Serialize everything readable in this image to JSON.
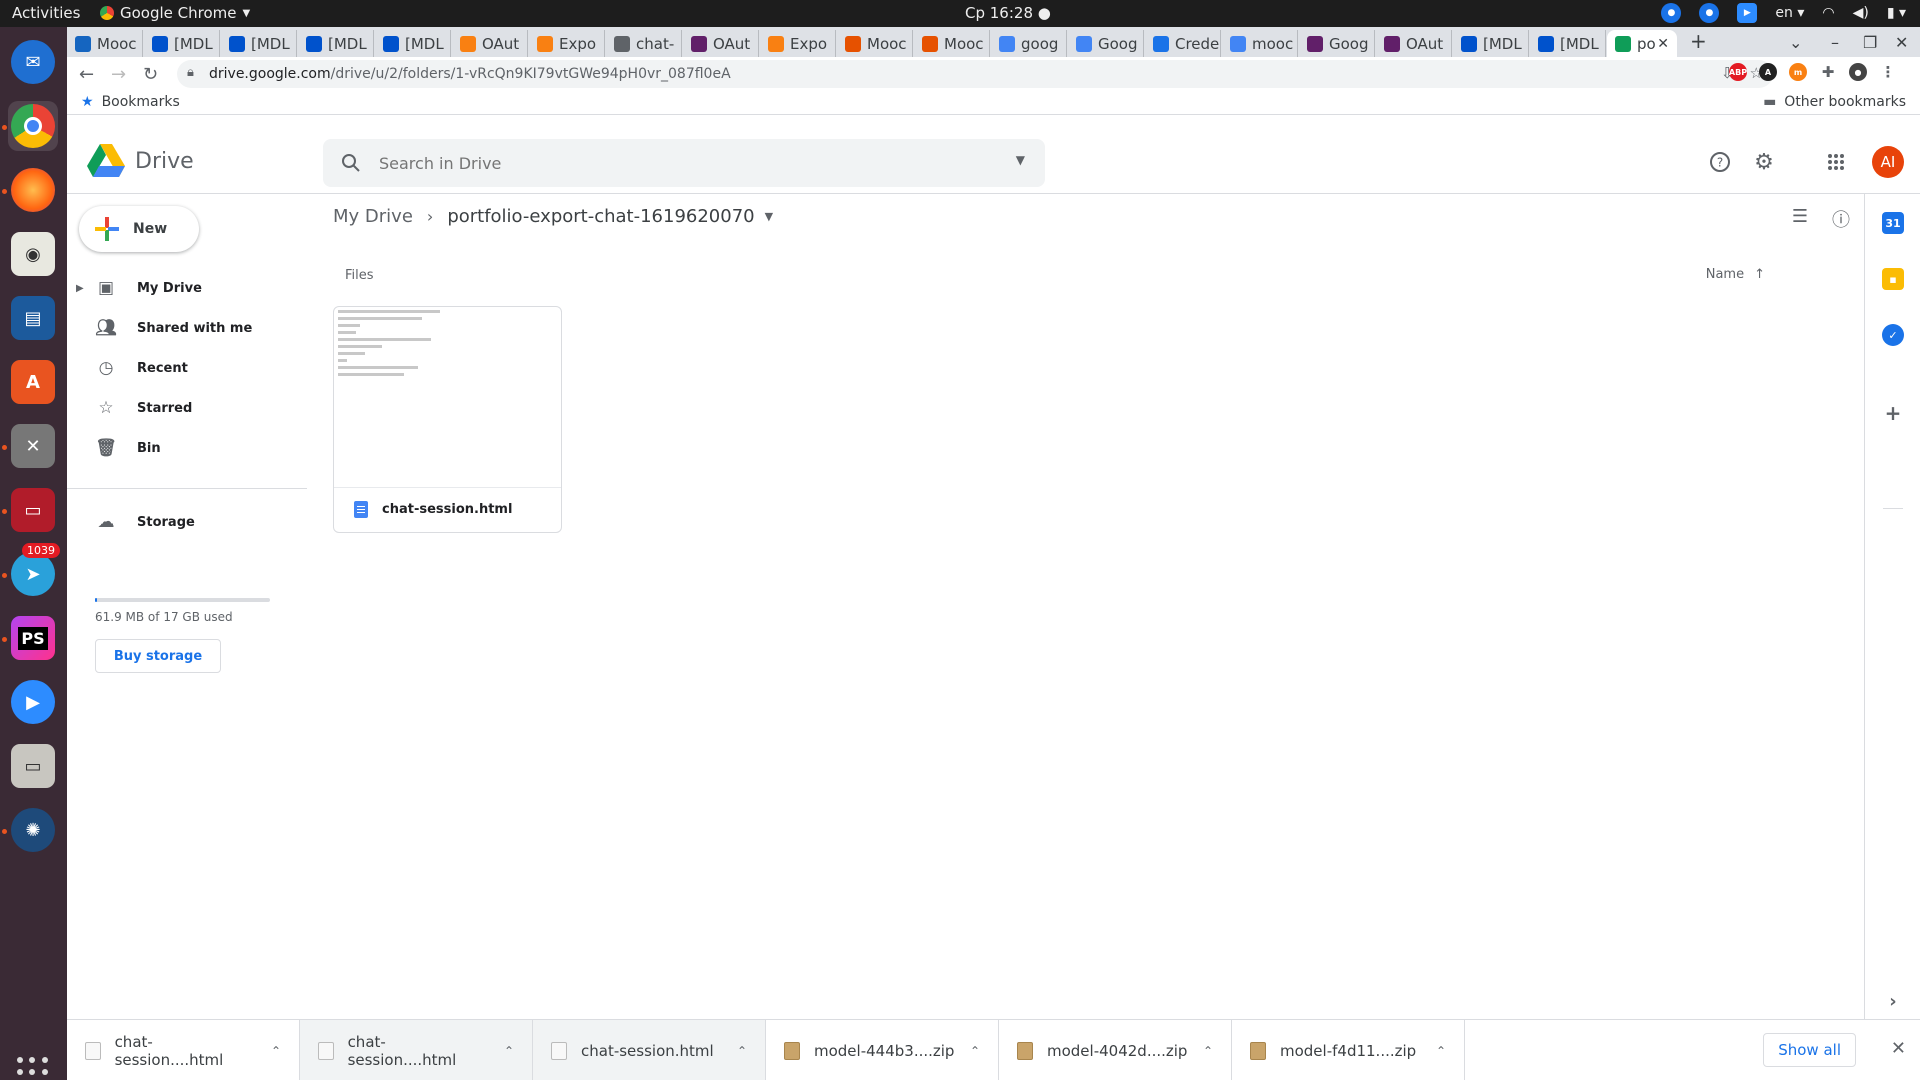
{
  "system": {
    "activities": "Activities",
    "app_name": "Google Chrome",
    "clock": "Ср 16:28",
    "language": "en",
    "dock_badge": "1039"
  },
  "browser": {
    "tabs": [
      {
        "label": "Mooc",
        "fav_color": "#1565c0"
      },
      {
        "label": "[MDL",
        "fav_color": "#0052cc"
      },
      {
        "label": "[MDL",
        "fav_color": "#0052cc"
      },
      {
        "label": "[MDL",
        "fav_color": "#0052cc"
      },
      {
        "label": "[MDL",
        "fav_color": "#0052cc"
      },
      {
        "label": "OAut",
        "fav_color": "#f98012"
      },
      {
        "label": "Expo",
        "fav_color": "#f98012"
      },
      {
        "label": "chat-",
        "fav_color": "#5f6368"
      },
      {
        "label": "OAut",
        "fav_color": "#611f69"
      },
      {
        "label": "Expo",
        "fav_color": "#f98012"
      },
      {
        "label": "Mooc",
        "fav_color": "#e65100"
      },
      {
        "label": "Mooc",
        "fav_color": "#e65100"
      },
      {
        "label": "goog",
        "fav_color": "#4285f4"
      },
      {
        "label": "Goog",
        "fav_color": "#4285f4"
      },
      {
        "label": "Crede",
        "fav_color": "#1a73e8"
      },
      {
        "label": "mooc",
        "fav_color": "#4285f4"
      },
      {
        "label": "Goog",
        "fav_color": "#611f69"
      },
      {
        "label": "OAut",
        "fav_color": "#611f69"
      },
      {
        "label": "[MDL",
        "fav_color": "#0052cc"
      },
      {
        "label": "[MDL",
        "fav_color": "#0052cc"
      },
      {
        "label": "po",
        "fav_color": "#0f9d58",
        "active": true
      }
    ],
    "url_host": "drive.google.com",
    "url_path": "/drive/u/2/folders/1-vRcQn9KI79vtGWe94pH0vr_087fl0eA",
    "bookmarks_label": "Bookmarks",
    "other_bookmarks": "Other bookmarks"
  },
  "drive": {
    "logo_text": "Drive",
    "search_placeholder": "Search in Drive",
    "avatar_initials": "AI",
    "new_label": "New",
    "nav": {
      "my_drive": "My Drive",
      "shared": "Shared with me",
      "recent": "Recent",
      "starred": "Starred",
      "bin": "Bin",
      "storage": "Storage"
    },
    "storage": {
      "used_text": "61.9 MB of 17 GB used",
      "used_fraction": 0.004,
      "buy_label": "Buy storage"
    },
    "breadcrumb": {
      "root": "My Drive",
      "current": "portfolio-export-chat-1619620070"
    },
    "files_label": "Files",
    "sort_label": "Name",
    "files": [
      {
        "name": "chat-session.html"
      }
    ]
  },
  "downloads": {
    "items": [
      {
        "name": "chat-session....html",
        "type": "html"
      },
      {
        "name": "chat-session....html",
        "type": "html"
      },
      {
        "name": "chat-session.html",
        "type": "html"
      },
      {
        "name": "model-444b3....zip",
        "type": "zip"
      },
      {
        "name": "model-4042d....zip",
        "type": "zip"
      },
      {
        "name": "model-f4d11....zip",
        "type": "zip"
      }
    ],
    "show_all": "Show all"
  },
  "colors": {
    "accent": "#1a73e8",
    "avatar": "#e8430a"
  }
}
